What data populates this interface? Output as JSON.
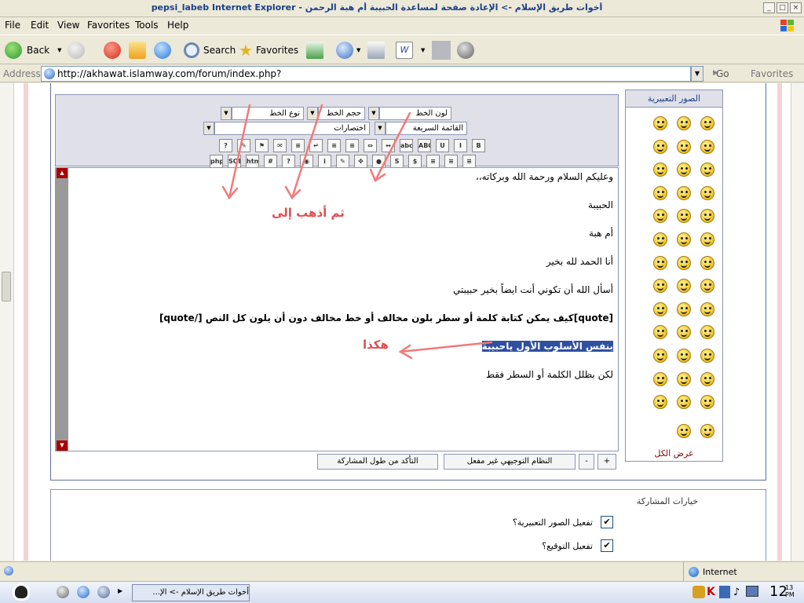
{
  "window": {
    "title": "pepsi_labeb Internet Explorer - أخوات طريق الإسلام -> الإعادة صفحة لمساعدة الحبيبة أم هبة الرحمن"
  },
  "menu": [
    "File",
    "Edit",
    "View",
    "Favorites",
    "Tools",
    "Help"
  ],
  "toolbar": {
    "back_label": "Back",
    "search_label": "Search",
    "favorites_label": "Favorites"
  },
  "address": {
    "label": "Address",
    "url": "http://akhawat.islamway.com/forum/index.php?",
    "go_label": "Go",
    "favorites_label": "Favorites"
  },
  "editor": {
    "font_color": "لون الخط",
    "font_size": "حجم الخط",
    "font_type": "نوع الخط",
    "quick_list": "القائمة السريعة",
    "shortcuts": "اختصارات",
    "buttons_row1": [
      "B",
      "I",
      "U",
      "ABC",
      "abc",
      "↔",
      "⇔",
      "≡",
      "≡",
      "↵",
      "≡",
      "✉",
      "⚑",
      "✎",
      "?"
    ],
    "buttons_row2": [
      "≡",
      "≡",
      "≡",
      "$",
      "S",
      "●",
      "✥",
      "✎",
      "i",
      "◉",
      "?",
      "#",
      "htm",
      "SQL",
      "php"
    ],
    "lines": [
      "وعليكم السلام ورحمة الله وبركاته،،",
      "الحبيبة",
      "أم هبة",
      "أنا الحمد لله بخير",
      "أسأل الله أن تكوني أنت ايضاً بخير حبيبتي",
      "[quote]كيف يمكن كتابة كلمة أو سطر بلون مخالف أو خط مخالف دون أن يلون كل النص [/quote]",
      "بنفس الأسلوب الأول ياحبيبة",
      "لكن بظلل الكلمة أو السطر فقط"
    ],
    "annotation_1": "ثم أذهب إلى",
    "annotation_2": "هكذا",
    "check_length": "التأكد من طول المشاركة",
    "guided_mode": "النظام التوجيهي غير مفعل",
    "minus": "-",
    "plus": "+"
  },
  "smilies": {
    "title": "الصور التعبيرية",
    "show_all": "عرض الكل"
  },
  "options": {
    "title": "خيارات المشاركة",
    "enable_smilies": "تفعيل الصور التعبيرية؟",
    "enable_signature": "تفعيل التوقيع؟"
  },
  "status": {
    "zone": "Internet"
  },
  "taskbar": {
    "task": "أخوات طريق الإسلام -> الإ...",
    "clock": "12",
    "clock_small": "13 PM"
  }
}
